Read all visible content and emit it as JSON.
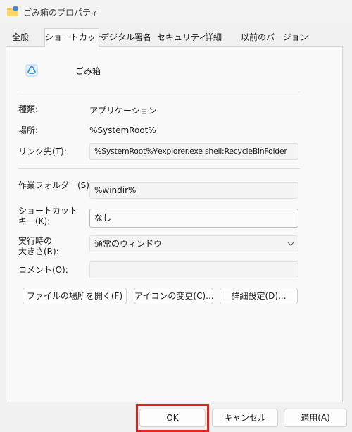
{
  "window": {
    "title": "ごみ箱のプロパティ"
  },
  "tabs": [
    {
      "label": "全般",
      "active": false
    },
    {
      "label": "ショートカット",
      "active": true
    },
    {
      "label": "デジタル署名",
      "active": false
    },
    {
      "label": "セキュリティ",
      "active": false
    },
    {
      "label": "詳細",
      "active": false
    },
    {
      "label": "以前のバージョン",
      "active": false
    }
  ],
  "app": {
    "name": "ごみ箱",
    "icon": "recycle-bin-icon"
  },
  "fields": {
    "type": {
      "label": "種類:",
      "value": "アプリケーション"
    },
    "location": {
      "label": "場所:",
      "value": "%SystemRoot%"
    },
    "target": {
      "label": "リンク先(T):",
      "value": "%SystemRoot%¥explorer.exe shell:RecycleBinFolder"
    },
    "start_in": {
      "label": "作業フォルダー(S):",
      "value": "%windir%"
    },
    "shortcut_key": {
      "label_line1": "ショートカット",
      "label_line2": "キー(K):",
      "value": "なし"
    },
    "run": {
      "label_line1": "実行時の",
      "label_line2": "大きさ(R):",
      "value": "通常のウィンドウ"
    },
    "comment": {
      "label": "コメント(O):",
      "value": ""
    }
  },
  "actions": {
    "open_location": "ファイルの場所を開く(F)",
    "change_icon": "アイコンの変更(C)...",
    "advanced": "詳細設定(D)..."
  },
  "dialog_buttons": {
    "ok": "OK",
    "cancel": "キャンセル",
    "apply": "適用(A)"
  },
  "colors": {
    "highlight": "#e0201b"
  }
}
